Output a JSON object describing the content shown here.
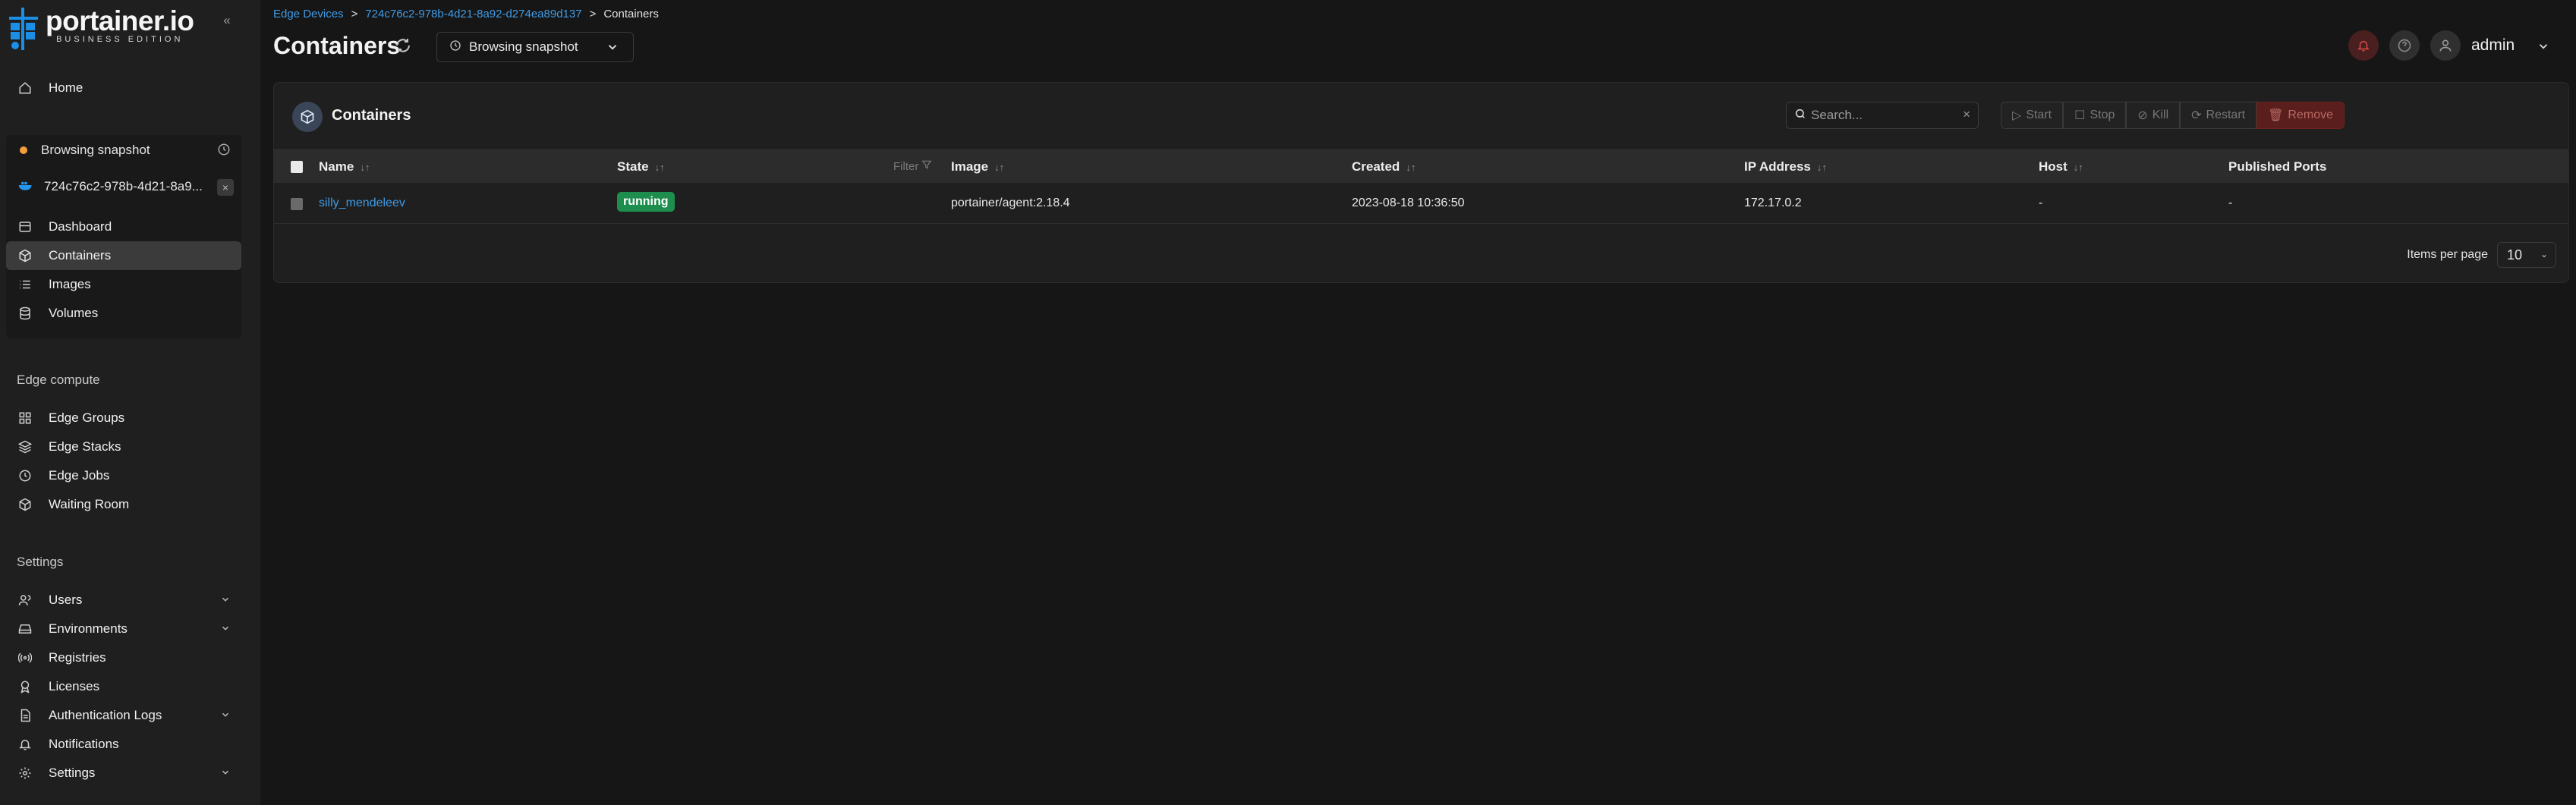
{
  "logo": {
    "main": "portainer.io",
    "sub": "BUSINESS EDITION"
  },
  "sidebar": {
    "home": "Home",
    "env": {
      "snapshot_label": "Browsing snapshot",
      "env_name": "724c76c2-978b-4d21-8a9...",
      "items": [
        "Dashboard",
        "Containers",
        "Images",
        "Volumes"
      ]
    },
    "edge_title": "Edge compute",
    "edge_items": [
      "Edge Groups",
      "Edge Stacks",
      "Edge Jobs",
      "Waiting Room"
    ],
    "settings_title": "Settings",
    "settings_items": [
      "Users",
      "Environments",
      "Registries",
      "Licenses",
      "Authentication Logs",
      "Notifications",
      "Settings"
    ]
  },
  "breadcrumb": {
    "b1": "Edge Devices",
    "sep": ">",
    "b2": "724c76c2-978b-4d21-8a92-d274ea89d137",
    "b3": "Containers"
  },
  "page_title": "Containers",
  "snapshot_select": "Browsing snapshot",
  "user": {
    "name": "admin"
  },
  "card": {
    "title": "Containers",
    "search_placeholder": "Search...",
    "buttons": {
      "start": "Start",
      "stop": "Stop",
      "kill": "Kill",
      "restart": "Restart",
      "remove": "Remove"
    }
  },
  "table": {
    "headers": {
      "name": "Name",
      "state": "State",
      "filter": "Filter",
      "image": "Image",
      "created": "Created",
      "ip": "IP Address",
      "host": "Host",
      "ports": "Published Ports"
    },
    "row": {
      "name": "silly_mendeleev",
      "state": "running",
      "image": "portainer/agent:2.18.4",
      "created": "2023-08-18 10:36:50",
      "ip": "172.17.0.2",
      "host": "-",
      "ports": "-"
    }
  },
  "pager": {
    "label": "Items per page",
    "value": "10"
  },
  "colors": {
    "accent": "#3f9be6",
    "running": "#1e8e4e",
    "snapshot_dot": "#f59f3a",
    "remove": "#5a1e1c"
  }
}
